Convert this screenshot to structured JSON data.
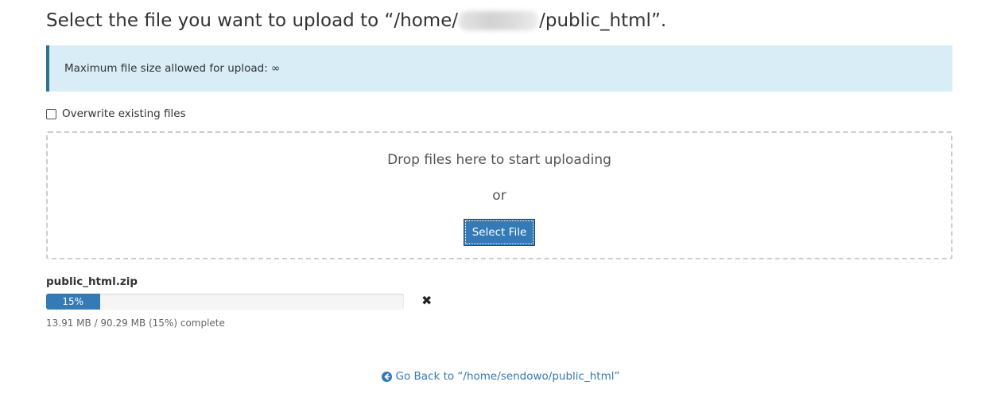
{
  "header": {
    "title_prefix": "Select the file you want to upload to “/home/",
    "title_suffix": "/public_html”."
  },
  "info": {
    "max_size_text": "Maximum file size allowed for upload: ∞"
  },
  "overwrite": {
    "label": "Overwrite existing files",
    "checked": false
  },
  "dropzone": {
    "text": "Drop files here to start uploading",
    "or_text": "or",
    "select_button": "Select File"
  },
  "upload": {
    "file_name": "public_html.zip",
    "progress_label": "15%",
    "progress_percent": 15,
    "status_text": "13.91 MB / 90.29 MB (15%) complete",
    "cancel_icon": "close-icon",
    "progress_color": "#337ab7"
  },
  "footer": {
    "go_back_label": "Go Back to “/home/sendowo/public_html”",
    "go_back_icon": "arrow-circle-left-icon"
  }
}
